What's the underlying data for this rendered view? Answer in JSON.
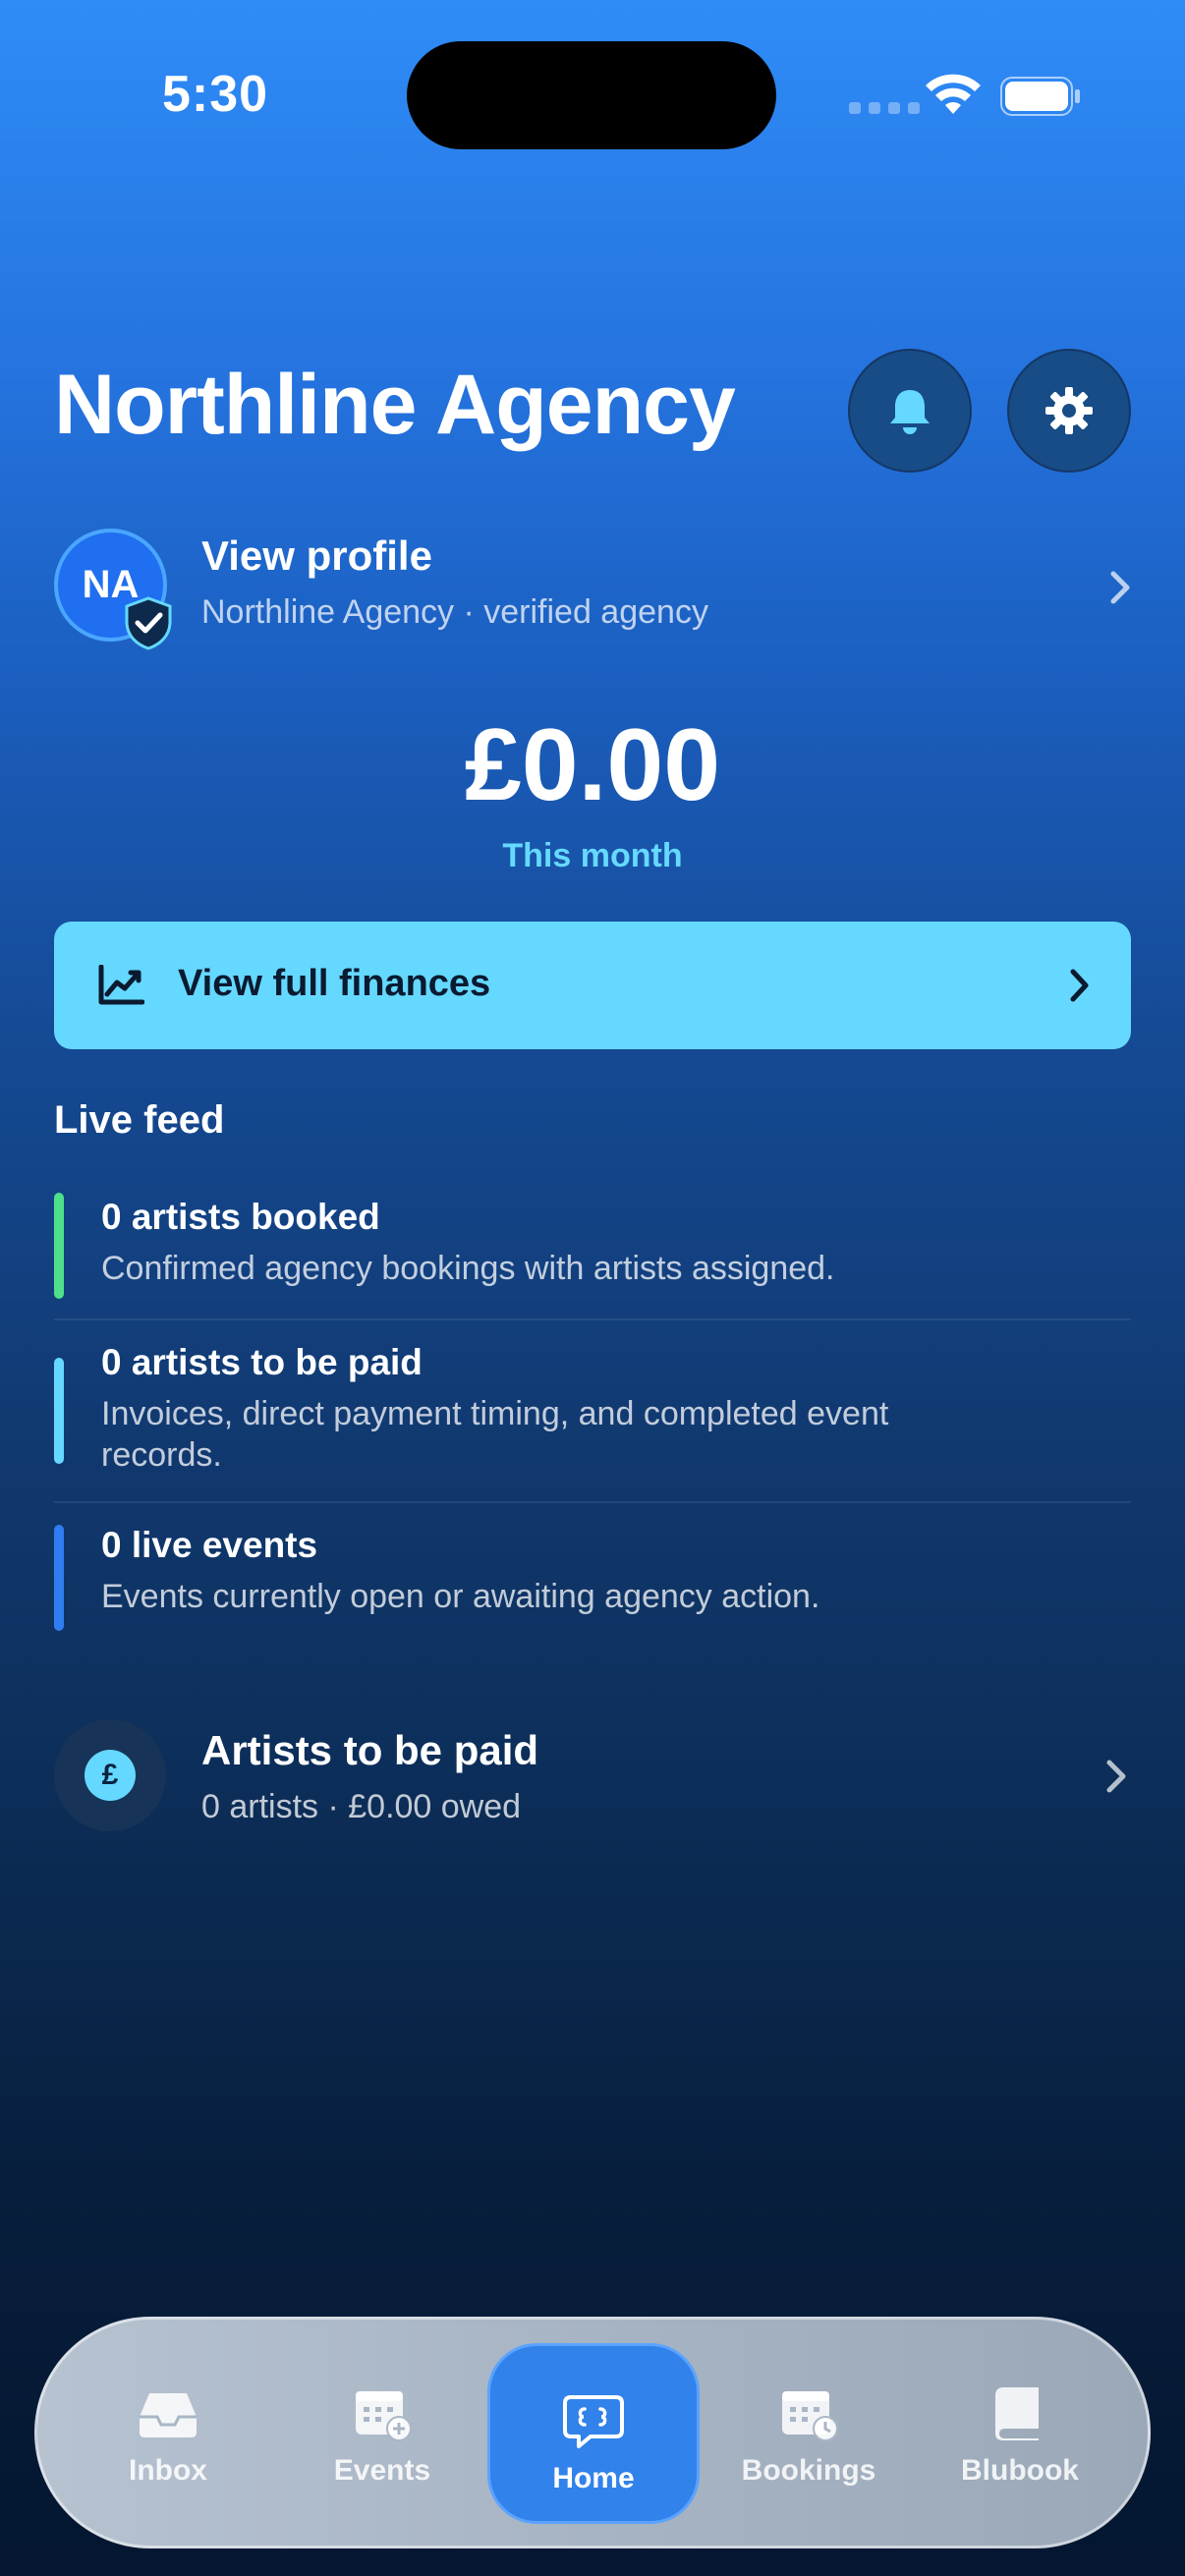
{
  "status_bar": {
    "time": "5:30"
  },
  "header": {
    "title": "Northline Agency"
  },
  "profile": {
    "initials": "NA",
    "title": "View profile",
    "subtitle": "Northline Agency · verified agency"
  },
  "balance": {
    "amount": "£0.00",
    "label": "This month"
  },
  "finances_button": {
    "label": "View full finances"
  },
  "live_feed": {
    "title": "Live feed",
    "items": [
      {
        "title": "0 artists booked",
        "desc": "Confirmed agency bookings with artists assigned.",
        "color": "#4ee08a"
      },
      {
        "title": "0 artists to be paid",
        "desc": "Invoices, direct payment timing, and completed event records.",
        "color": "#65d8ff"
      },
      {
        "title": "0 live events",
        "desc": "Events currently open or awaiting agency action.",
        "color": "#2f7df0"
      }
    ]
  },
  "artists_to_pay": {
    "icon_symbol": "£",
    "title": "Artists to be paid",
    "subtitle": "0 artists · £0.00 owed"
  },
  "tab_bar": {
    "tabs": [
      {
        "label": "Inbox",
        "icon": "inbox-icon"
      },
      {
        "label": "Events",
        "icon": "calendar-add-icon"
      },
      {
        "label": "Home",
        "icon": "chat-bubble-icon"
      },
      {
        "label": "Bookings",
        "icon": "calendar-clock-icon"
      },
      {
        "label": "Blubook",
        "icon": "book-icon"
      }
    ],
    "active": "Home"
  },
  "colors": {
    "accent": "#65d8ff",
    "active_tab": "#3182ea"
  }
}
